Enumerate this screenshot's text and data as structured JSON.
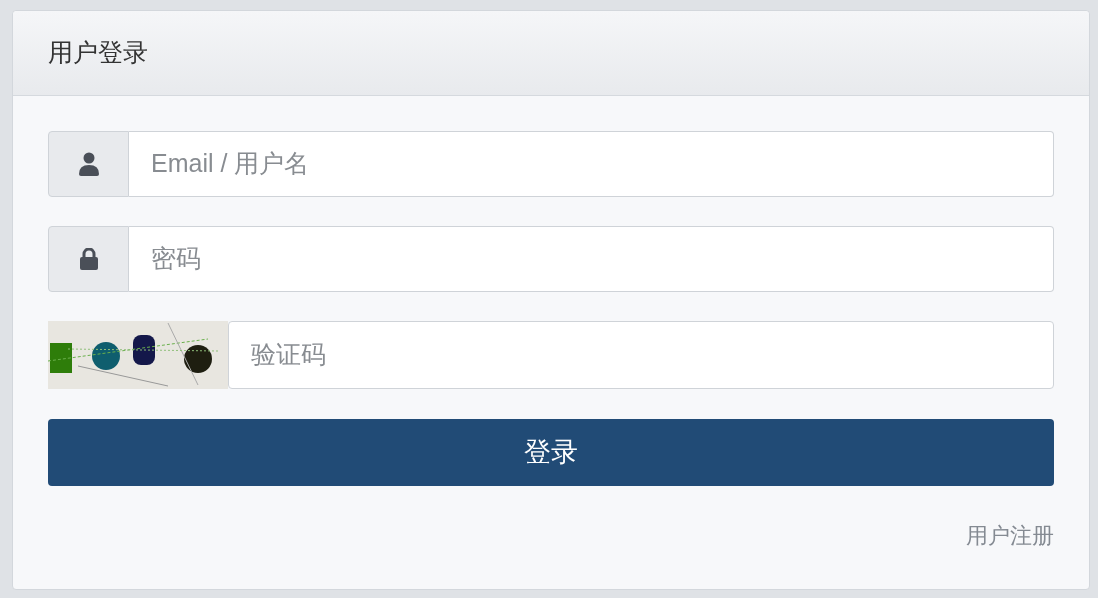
{
  "panel": {
    "title": "用户登录"
  },
  "fields": [
    {
      "kind": "user",
      "placeholder": "Email / 用户名"
    },
    {
      "kind": "lock",
      "placeholder": "密码"
    },
    {
      "kind": "captcha",
      "placeholder": "验证码"
    }
  ],
  "submit_button": "登录",
  "register_link": "用户注册"
}
